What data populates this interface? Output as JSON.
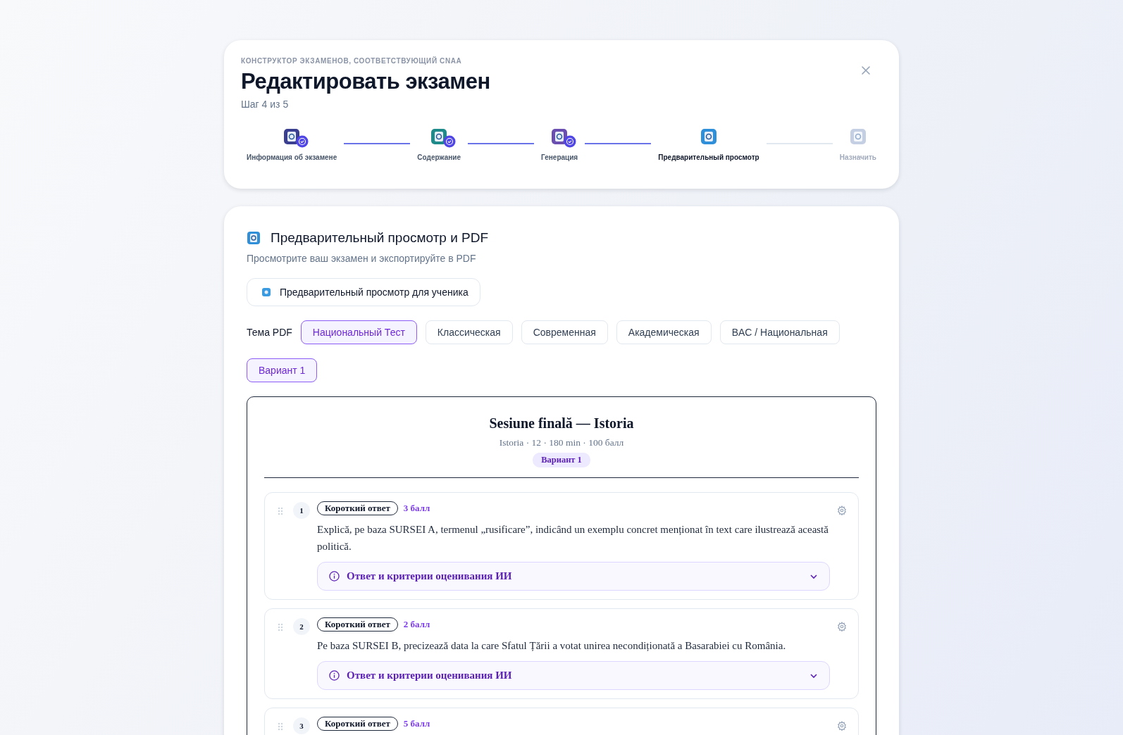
{
  "header": {
    "eyebrow": "КОНСТРУКТОР ЭКЗАМЕНОВ, СООТВЕТСТВУЮЩИЙ CNAA",
    "title": "Редактировать экзамен",
    "step_info": "Шаг 4 из 5"
  },
  "steps": [
    {
      "label": "Информация об экзамене",
      "completed": true,
      "selected": false
    },
    {
      "label": "Содержание",
      "completed": true,
      "selected": false
    },
    {
      "label": "Генерация",
      "completed": true,
      "selected": false
    },
    {
      "label": "Предварительный просмотр",
      "completed": false,
      "selected": true
    },
    {
      "label": "Назначить",
      "completed": false,
      "selected": false
    }
  ],
  "preview": {
    "title": "Предварительный просмотр и PDF",
    "subtitle": "Просмотрите ваш экзамен и экспортируйте в PDF",
    "student_button": "Предварительный просмотр для ученика",
    "theme_label": "Тема PDF",
    "themes": [
      {
        "label": "Национальный Тест",
        "selected": true
      },
      {
        "label": "Классическая",
        "selected": false
      },
      {
        "label": "Современная",
        "selected": false
      },
      {
        "label": "Академическая",
        "selected": false
      },
      {
        "label": "BAC / Национальная",
        "selected": false
      }
    ],
    "variants": [
      {
        "label": "Вариант 1",
        "selected": true
      }
    ]
  },
  "paper": {
    "title": "Sesiune finală — Istoria",
    "meta": "Istoria · 12 · 180 min · 100 балл",
    "variant": "Вариант 1",
    "questions": [
      {
        "number": "1",
        "tag": "Короткий ответ",
        "points": "3 балл",
        "text": "Explică, pe baza SURSEI A, termenul „rusificare”, indicând un exemplu concret menționat în text care ilustrează această politică.",
        "answer_label": "Ответ и критерии оценивания ИИ"
      },
      {
        "number": "2",
        "tag": "Короткий ответ",
        "points": "2 балл",
        "text": "Pe baza SURSEI B, precizează data la care Sfatul Țării a votat unirea necondiționată a Basarabiei cu România.",
        "answer_label": "Ответ и критерии оценивания ИИ"
      },
      {
        "number": "3",
        "tag": "Короткий ответ",
        "points": "5 балл"
      }
    ]
  }
}
